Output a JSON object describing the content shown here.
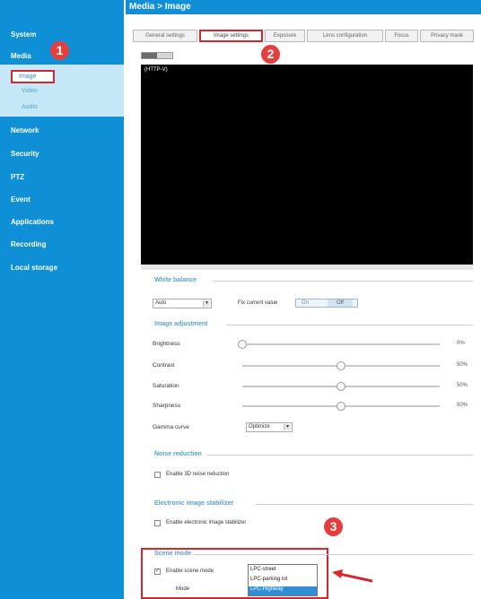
{
  "header": {
    "title": "Media > Image"
  },
  "sidebar": {
    "items": [
      {
        "label": "System"
      },
      {
        "label": "Media"
      },
      {
        "label": "Network"
      },
      {
        "label": "Security"
      },
      {
        "label": "PTZ"
      },
      {
        "label": "Event"
      },
      {
        "label": "Applications"
      },
      {
        "label": "Recording"
      },
      {
        "label": "Local storage"
      }
    ],
    "media_sub": [
      {
        "label": "Image"
      },
      {
        "label": "Video"
      },
      {
        "label": "Audio"
      }
    ]
  },
  "tabs": [
    {
      "label": "General settings"
    },
    {
      "label": "Image settings"
    },
    {
      "label": "Exposure"
    },
    {
      "label": "Lens configuration"
    },
    {
      "label": "Focus"
    },
    {
      "label": "Privacy mask"
    }
  ],
  "badges": {
    "one": "1",
    "two": "2",
    "three": "3"
  },
  "viewer": {
    "stream_label": "(HTTP-V)"
  },
  "white_balance": {
    "title": "White balance",
    "mode": "Auto",
    "fix_label": "Fix current value",
    "on": "On",
    "off": "Off"
  },
  "image_adjustment": {
    "title": "Image adjustment",
    "rows": [
      {
        "label": "Brightness",
        "value": "0%",
        "level": 0
      },
      {
        "label": "Contrast",
        "value": "50%",
        "level": 0.5
      },
      {
        "label": "Saturation",
        "value": "50%",
        "level": 0.5
      },
      {
        "label": "Sharpness",
        "value": "50%",
        "level": 0.5
      }
    ],
    "gamma_label": "Gamma curve",
    "gamma_value": "Optimize"
  },
  "noise_reduction": {
    "title": "Noise reduction",
    "checkbox_label": "Enable 3D noise reduction"
  },
  "stabilizer": {
    "title": "Electronic image stabilizer",
    "checkbox_label": "Enable electronic image stabilizer"
  },
  "scene_mode": {
    "title": "Scene mode",
    "checkbox_label": "Enable scene mode",
    "mode_label": "Mode",
    "options": [
      "LPC-street",
      "LPC-parking lot",
      "LPC-Highway"
    ],
    "selected": "LPC-Highway"
  },
  "colors": {
    "sidebar": "#0f90d6",
    "highlight": "#d8262d",
    "accent": "#5a9fc9"
  }
}
